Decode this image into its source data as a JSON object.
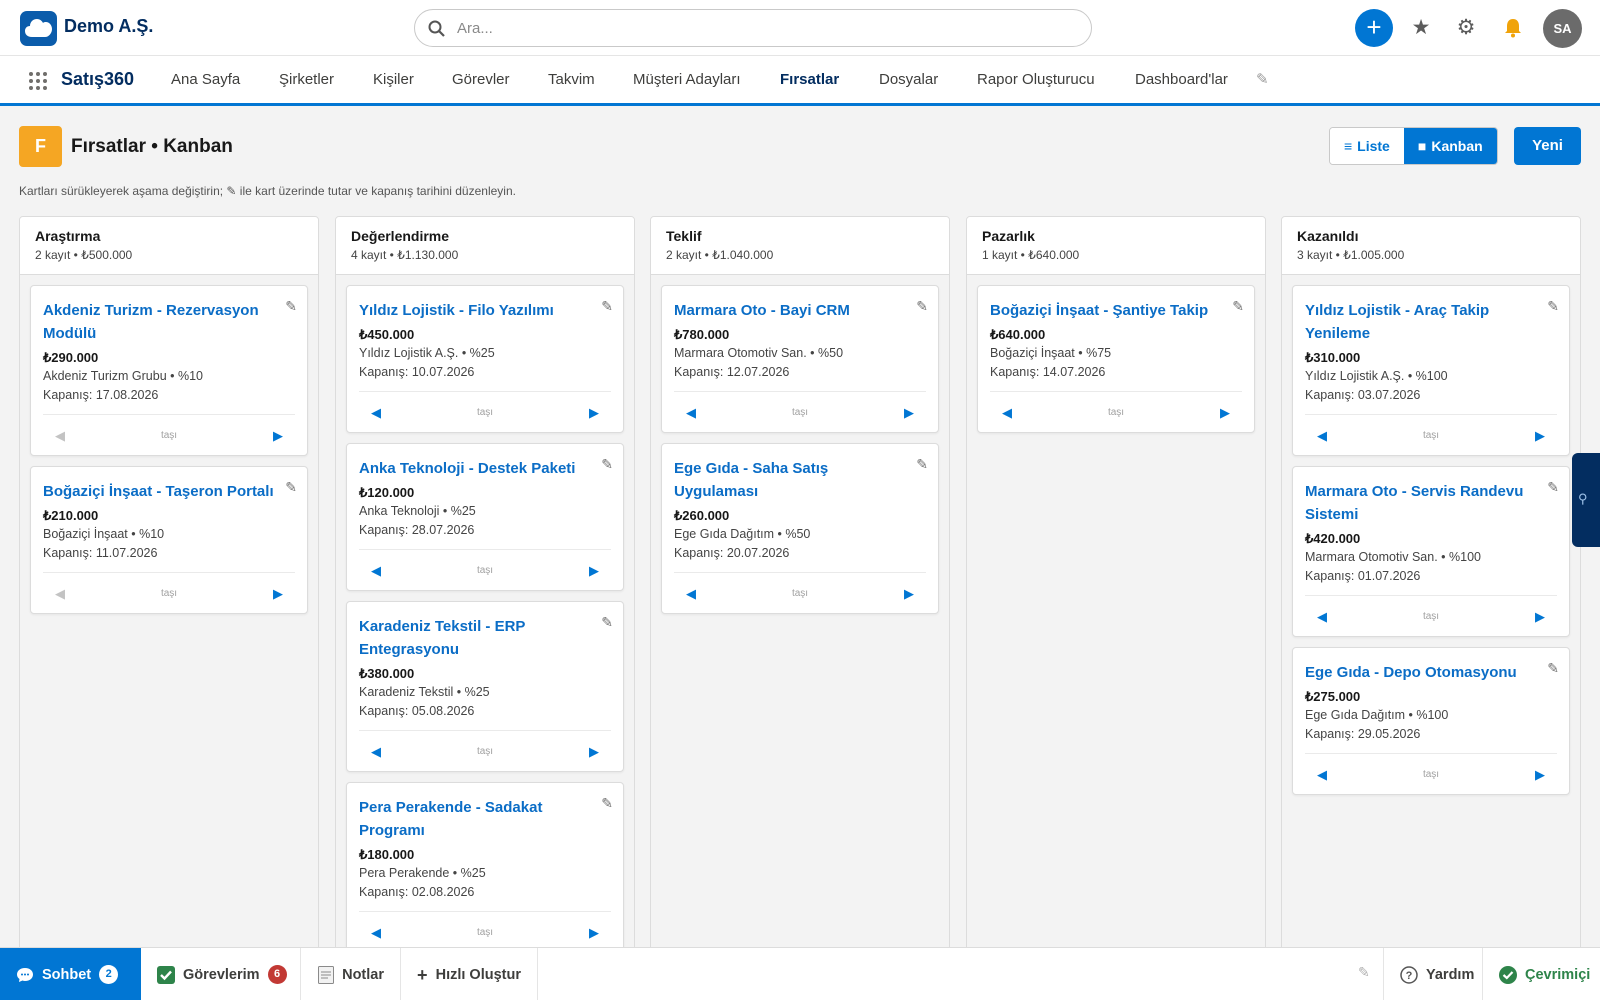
{
  "header": {
    "org_name": "Demo A.Ş.",
    "search_placeholder": "Ara...",
    "add_label": "+",
    "avatar_initials": "SA"
  },
  "nav": {
    "app_name": "Satış360",
    "items": [
      "Ana Sayfa",
      "Şirketler",
      "Kişiler",
      "Görevler",
      "Takvim",
      "Müşteri Adayları",
      "Fırsatlar",
      "Dosyalar",
      "Rapor Oluşturucu",
      "Dashboard'lar"
    ],
    "active": "Fırsatlar",
    "edit_icon": "✎"
  },
  "page": {
    "icon_letter": "F",
    "title": "Fırsatlar • Kanban",
    "views": {
      "list": "Liste",
      "kanban": "Kanban",
      "active": "kanban"
    },
    "new_label": "Yeni",
    "hint": "Kartları sürükleyerek aşama değiştirin; ✎ ile kart üzerinde tutar ve kapanış tarihini düzenleyin."
  },
  "board": {
    "move_label": "taşı",
    "columns": [
      {
        "title": "Araştırma",
        "summary": "2 kayıt • ₺500.000",
        "cards": [
          {
            "title": "Akdeniz Turizm - Rezervasyon Modülü",
            "amount": "₺290.000",
            "account": "Akdeniz Turizm Grubu • %10",
            "close": "Kapanış: 17.08.2026"
          },
          {
            "title": "Boğaziçi İnşaat - Taşeron Portalı",
            "amount": "₺210.000",
            "account": "Boğaziçi İnşaat • %10",
            "close": "Kapanış: 11.07.2026"
          }
        ]
      },
      {
        "title": "Değerlendirme",
        "summary": "4 kayıt • ₺1.130.000",
        "cards": [
          {
            "title": "Yıldız Lojistik - Filo Yazılımı",
            "amount": "₺450.000",
            "account": "Yıldız Lojistik A.Ş. • %25",
            "close": "Kapanış: 10.07.2026"
          },
          {
            "title": "Anka Teknoloji - Destek Paketi",
            "amount": "₺120.000",
            "account": "Anka Teknoloji • %25",
            "close": "Kapanış: 28.07.2026"
          },
          {
            "title": "Karadeniz Tekstil - ERP Entegrasyonu",
            "amount": "₺380.000",
            "account": "Karadeniz Tekstil • %25",
            "close": "Kapanış: 05.08.2026"
          },
          {
            "title": "Pera Perakende - Sadakat Programı",
            "amount": "₺180.000",
            "account": "Pera Perakende • %25",
            "close": "Kapanış: 02.08.2026"
          }
        ]
      },
      {
        "title": "Teklif",
        "summary": "2 kayıt • ₺1.040.000",
        "cards": [
          {
            "title": "Marmara Oto - Bayi CRM",
            "amount": "₺780.000",
            "account": "Marmara Otomotiv San. • %50",
            "close": "Kapanış: 12.07.2026"
          },
          {
            "title": "Ege Gıda - Saha Satış Uygulaması",
            "amount": "₺260.000",
            "account": "Ege Gıda Dağıtım • %50",
            "close": "Kapanış: 20.07.2026"
          }
        ]
      },
      {
        "title": "Pazarlık",
        "summary": "1 kayıt • ₺640.000",
        "cards": [
          {
            "title": "Boğaziçi İnşaat - Şantiye Takip",
            "amount": "₺640.000",
            "account": "Boğaziçi İnşaat • %75",
            "close": "Kapanış: 14.07.2026"
          }
        ]
      },
      {
        "title": "Kazanıldı",
        "summary": "3 kayıt • ₺1.005.000",
        "cards": [
          {
            "title": "Yıldız Lojistik - Araç Takip Yenileme",
            "amount": "₺310.000",
            "account": "Yıldız Lojistik A.Ş. • %100",
            "close": "Kapanış: 03.07.2026"
          },
          {
            "title": "Marmara Oto - Servis Randevu Sistemi",
            "amount": "₺420.000",
            "account": "Marmara Otomotiv San. • %100",
            "close": "Kapanış: 01.07.2026"
          },
          {
            "title": "Ege Gıda - Depo Otomasyonu",
            "amount": "₺275.000",
            "account": "Ege Gıda Dağıtım • %100",
            "close": "Kapanış: 29.05.2026"
          }
        ]
      }
    ]
  },
  "utility": {
    "chat": {
      "label": "Sohbet",
      "count": "2"
    },
    "tasks": {
      "label": "Görevlerim",
      "count": "6"
    },
    "notes": {
      "label": "Notlar"
    },
    "quick_create": {
      "label": "Hızlı Oluştur"
    },
    "help": {
      "label": "Yardım"
    },
    "status": {
      "label": "Çevrimiçi"
    }
  },
  "colors": {
    "brand": "#0176d3",
    "brand_dark": "#032d60",
    "object_icon": "#f5a623",
    "badge_red": "#c23934",
    "online_green": "#2e844a"
  }
}
